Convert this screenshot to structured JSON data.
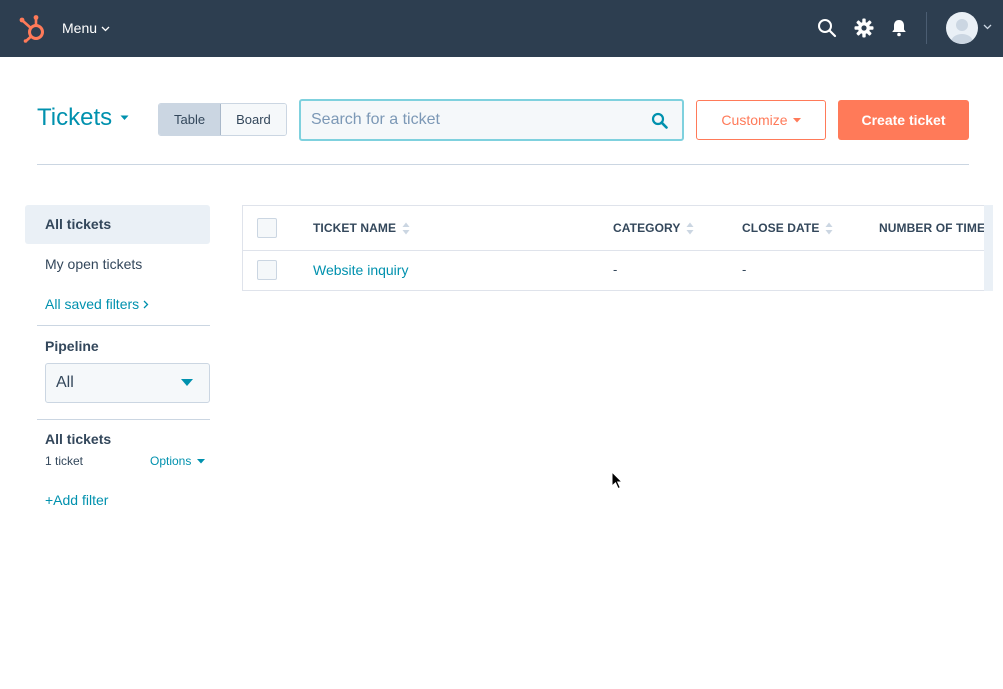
{
  "nav": {
    "menu_label": "Menu",
    "icons": [
      "hubspot-logo",
      "search-icon",
      "gear-icon",
      "bell-icon",
      "avatar"
    ]
  },
  "header": {
    "title": "Tickets",
    "view_toggle": [
      "Table",
      "Board"
    ],
    "active_view": "Table",
    "search_placeholder": "Search for a ticket",
    "customize_label": "Customize",
    "create_label": "Create ticket"
  },
  "sidebar": {
    "items": [
      {
        "label": "All tickets"
      },
      {
        "label": "My open tickets"
      }
    ],
    "saved_filters_label": "All saved filters",
    "pipeline_label": "Pipeline",
    "pipeline_value": "All",
    "view_title": "All tickets",
    "view_count": "1 ticket",
    "options_label": "Options",
    "add_filter_label": "+Add filter"
  },
  "table": {
    "columns": [
      "TICKET NAME",
      "CATEGORY",
      "CLOSE DATE",
      "NUMBER OF TIMES C"
    ],
    "rows": [
      {
        "name": "Website inquiry",
        "category": "-",
        "close_date": "-"
      }
    ]
  },
  "colors": {
    "nav_bg": "#2d3e50",
    "accent_teal": "#0091ae",
    "accent_orange": "#ff7a59"
  }
}
